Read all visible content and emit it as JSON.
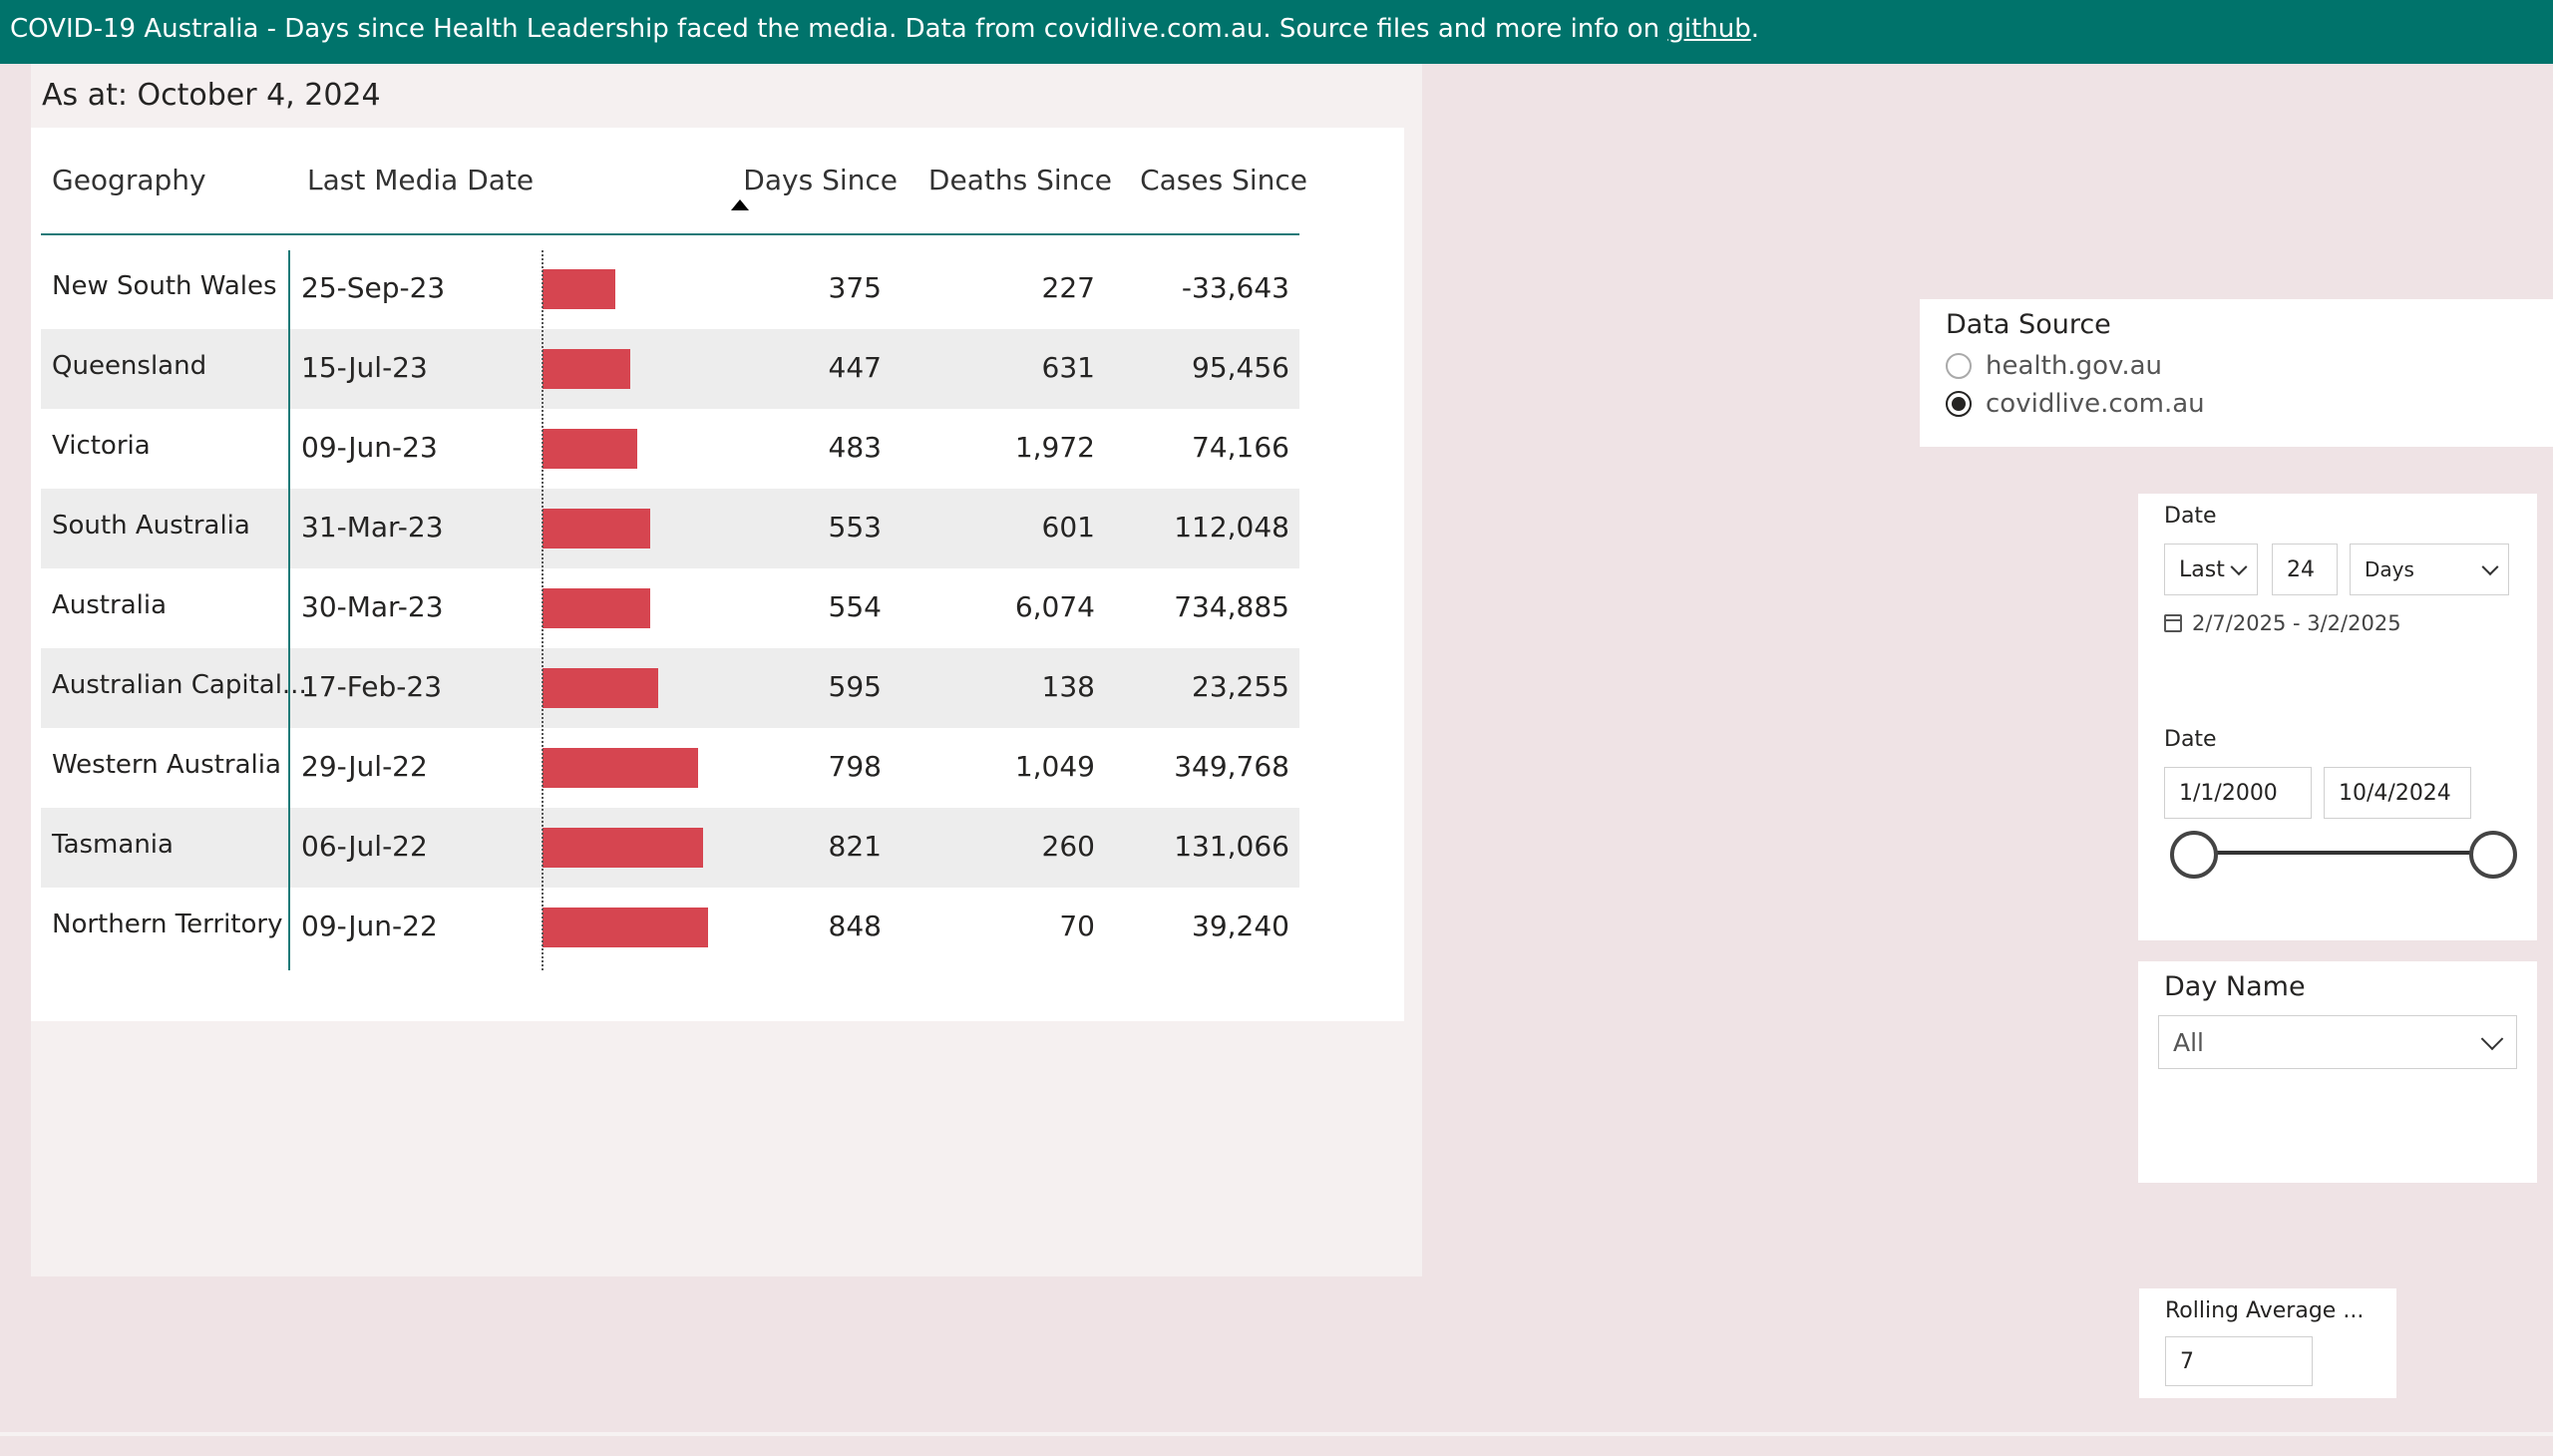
{
  "banner": {
    "text": "COVID-19 Australia - Days since Health Leadership faced the media. Data from covidlive.com.au. Source files and more info on ",
    "link": "github",
    "suffix": "."
  },
  "as_at": "As at: October 4, 2024",
  "table": {
    "headers": {
      "geography": "Geography",
      "last_media_date": "Last Media Date",
      "days_since": "Days Since",
      "deaths_since": "Deaths Since",
      "cases_since": "Cases Since"
    },
    "bar_color": "#d64550",
    "rows": [
      {
        "geo": "New South Wales",
        "date": "25-Sep-23",
        "days": "375",
        "deaths": "227",
        "cases": "-33,643"
      },
      {
        "geo": "Queensland",
        "date": "15-Jul-23",
        "days": "447",
        "deaths": "631",
        "cases": "95,456"
      },
      {
        "geo": "Victoria",
        "date": "09-Jun-23",
        "days": "483",
        "deaths": "1,972",
        "cases": "74,166"
      },
      {
        "geo": "South Australia",
        "date": "31-Mar-23",
        "days": "553",
        "deaths": "601",
        "cases": "112,048"
      },
      {
        "geo": "Australia",
        "date": "30-Mar-23",
        "days": "554",
        "deaths": "6,074",
        "cases": "734,885"
      },
      {
        "geo": "Australian Capital...",
        "date": "17-Feb-23",
        "days": "595",
        "deaths": "138",
        "cases": "23,255"
      },
      {
        "geo": "Western Australia",
        "date": "29-Jul-22",
        "days": "798",
        "deaths": "1,049",
        "cases": "349,768"
      },
      {
        "geo": "Tasmania",
        "date": "06-Jul-22",
        "days": "821",
        "deaths": "260",
        "cases": "131,066"
      },
      {
        "geo": "Northern Territory",
        "date": "09-Jun-22",
        "days": "848",
        "deaths": "70",
        "cases": "39,240"
      }
    ]
  },
  "data_source": {
    "title": "Data Source",
    "options": [
      {
        "label": "health.gov.au",
        "selected": false
      },
      {
        "label": "covidlive.com.au",
        "selected": true
      }
    ]
  },
  "date_relative": {
    "title": "Date",
    "mode": "Last",
    "count": "24",
    "unit": "Days",
    "range": "2/7/2025 - 3/2/2025"
  },
  "date_between": {
    "title": "Date",
    "start": "1/1/2000",
    "end": "10/4/2024"
  },
  "day_name": {
    "title": "Day Name",
    "value": "All"
  },
  "rolling_average": {
    "title": "Rolling Average ...",
    "value": "7"
  },
  "colors": {
    "banner": "#00736b",
    "accent_line": "#1f7a78",
    "background": "#efe3e5"
  }
}
